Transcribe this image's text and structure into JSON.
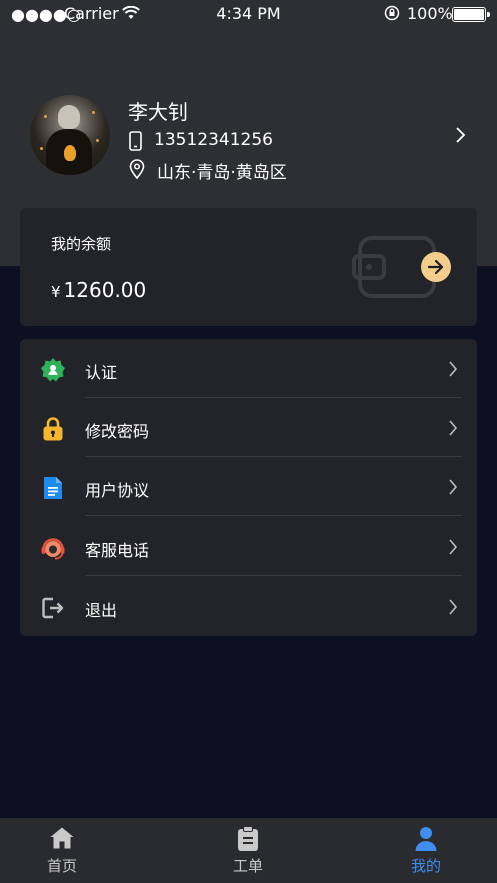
{
  "status_bar": {
    "signal": "●●●●○",
    "carrier": "Carrier",
    "time": "4:34 PM",
    "battery": "100%"
  },
  "profile": {
    "name": "李大钊",
    "phone": "13512341256",
    "location": "山东·青岛·黄岛区"
  },
  "balance": {
    "label": "我的余额",
    "currency": "¥",
    "amount": "1260.00",
    "accent_color": "#f3cd8b"
  },
  "menu": {
    "items": [
      {
        "label": "认证",
        "icon": "certification-badge-icon"
      },
      {
        "label": "修改密码",
        "icon": "lock-icon"
      },
      {
        "label": "用户协议",
        "icon": "document-icon"
      },
      {
        "label": "客服电话",
        "icon": "headset-icon"
      },
      {
        "label": "退出",
        "icon": "logout-icon"
      }
    ]
  },
  "tabs": {
    "items": [
      {
        "label": "首页",
        "icon": "home-icon"
      },
      {
        "label": "工单",
        "icon": "clipboard-icon"
      },
      {
        "label": "我的",
        "icon": "user-icon"
      }
    ],
    "active": "我的",
    "active_color": "#3e8ef0"
  }
}
